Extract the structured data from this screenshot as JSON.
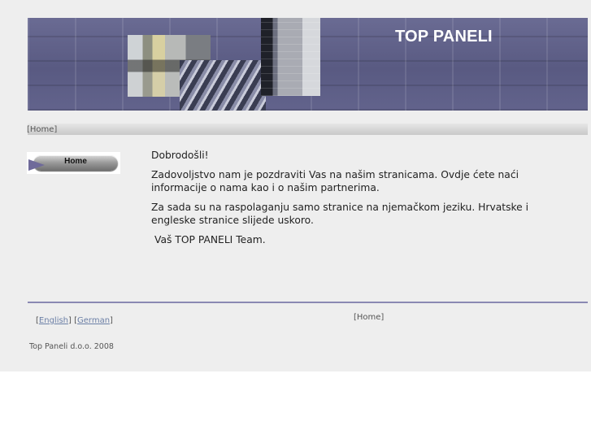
{
  "header": {
    "brand": "TOP PANELI"
  },
  "breadcrumb": {
    "text": "[Home]"
  },
  "sidebar": {
    "home_label": "Home"
  },
  "content": {
    "greeting": "Dobrodošli!",
    "paragraph1": "Zadovoljstvo nam je pozdraviti Vas na našim stranicama. Ovdje ćete naći informacije o nama kao i o našim partnerima.",
    "paragraph2": "Za sada su na raspolaganju samo stranice na njemačkom jeziku. Hrvatske i engleske stranice slijede uskoro.",
    "signature": "Vaš TOP PANELI Team."
  },
  "footer": {
    "english_link": "English",
    "german_link": "German",
    "bracket_open": "[",
    "bracket_mid": "] [",
    "bracket_close": "]",
    "breadcrumb": "[Home]",
    "copyright": "Top Paneli d.o.o. 2008"
  },
  "colors": {
    "banner": "#5d5e86",
    "page_background": "#eeeeee",
    "link": "#6b7fa6",
    "footer_rule": "#8a89b3"
  }
}
